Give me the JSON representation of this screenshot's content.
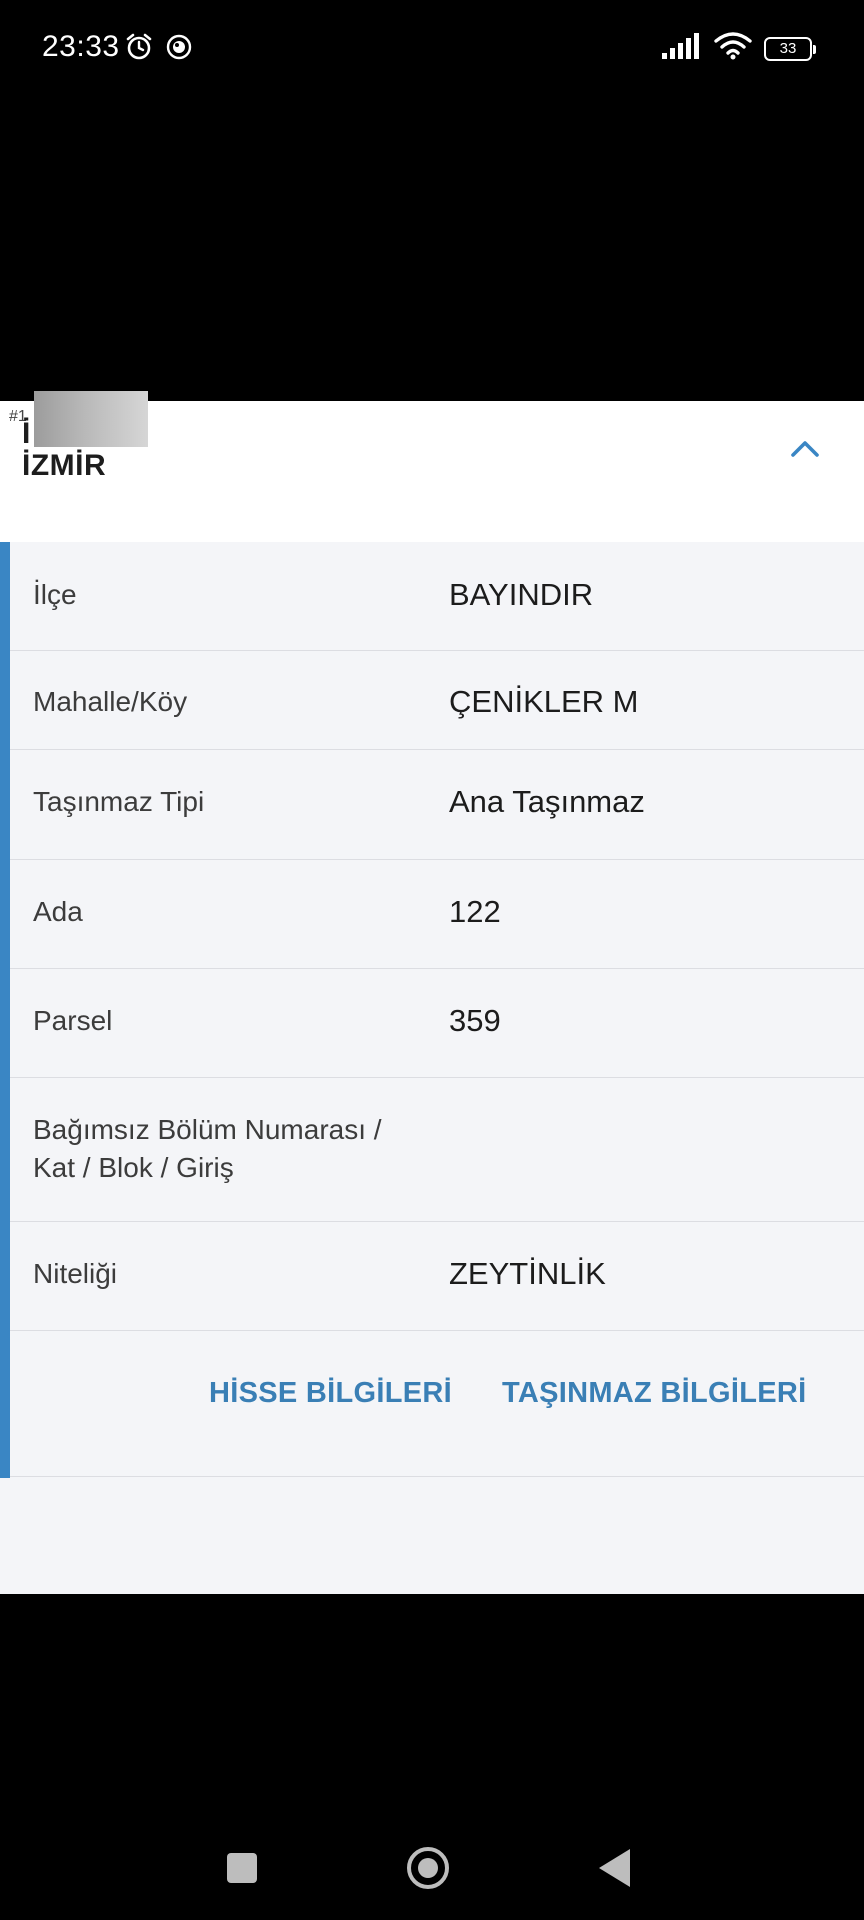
{
  "status_bar": {
    "time": "23:33",
    "battery": "33"
  },
  "header": {
    "hash": "#1",
    "line1": "İ",
    "title": "İZMİR"
  },
  "rows": [
    {
      "label": "İlçe",
      "value": "BAYINDIR"
    },
    {
      "label": "Mahalle/Köy",
      "value": "ÇENİKLER M"
    },
    {
      "label": "Taşınmaz Tipi",
      "value": "Ana Taşınmaz"
    },
    {
      "label": "Ada",
      "value": "122"
    },
    {
      "label": "Parsel",
      "value": "359"
    },
    {
      "label_line1": "Bağımsız Bölüm Numarası /",
      "label_line2": "Kat / Blok / Giriş",
      "value": ""
    },
    {
      "label": "Niteliği",
      "value": "ZEYTİNLİK"
    }
  ],
  "actions": {
    "share_info": "HİSSE BİLGİLERİ",
    "property_info": "TAŞINMAZ BİLGİLERİ"
  },
  "colors": {
    "accent": "#3a86c4",
    "action_text": "#3a7fb5",
    "card_bg": "#f4f5f8"
  },
  "icons": [
    "alarm-icon",
    "app-notification-icon",
    "signal-icon",
    "wifi-icon",
    "battery-icon",
    "chevron-up-icon",
    "recent-apps-icon",
    "home-icon",
    "back-icon"
  ]
}
